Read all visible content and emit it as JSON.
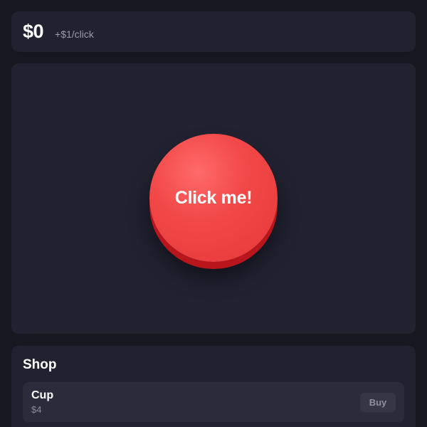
{
  "stats": {
    "money": "$0",
    "rate": "+$1/click"
  },
  "clicker": {
    "label": "Click me!",
    "color": "#f24848"
  },
  "shop": {
    "title": "Shop",
    "items": [
      {
        "name": "Cup",
        "price": "$4",
        "buy_label": "Buy"
      }
    ]
  }
}
